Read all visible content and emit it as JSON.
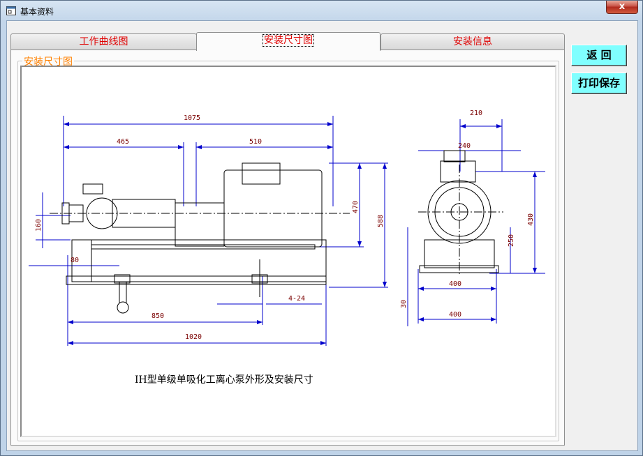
{
  "window": {
    "title": "基本资料",
    "close_glyph": "x"
  },
  "tabs": [
    {
      "label": "工作曲线图",
      "active": false
    },
    {
      "label": "安装尺寸图",
      "active": true
    },
    {
      "label": "安装信息",
      "active": false
    }
  ],
  "group": {
    "label": "安装尺寸图"
  },
  "drawing": {
    "caption": "IH型单级单吸化工离心泵外形及安装尺寸",
    "dimensions": {
      "overall_length": "1075",
      "pump_section": "465",
      "motor_section": "510",
      "height_470": "470",
      "height_588": "588",
      "flange_160": "160",
      "offset_80": "80",
      "bolt_holes": "4-24",
      "base_850": "850",
      "base_1020": "1020",
      "side_210": "210",
      "side_240": "240",
      "side_430": "430",
      "side_250": "250",
      "side_30": "30",
      "side_400_top": "400",
      "side_400_bottom": "400"
    },
    "colors": {
      "dimension_line": "#0000cc",
      "dimension_text": "#7a0000",
      "outline": "#000000"
    }
  },
  "buttons": {
    "back": "返  回",
    "print_save": "打印保存"
  }
}
